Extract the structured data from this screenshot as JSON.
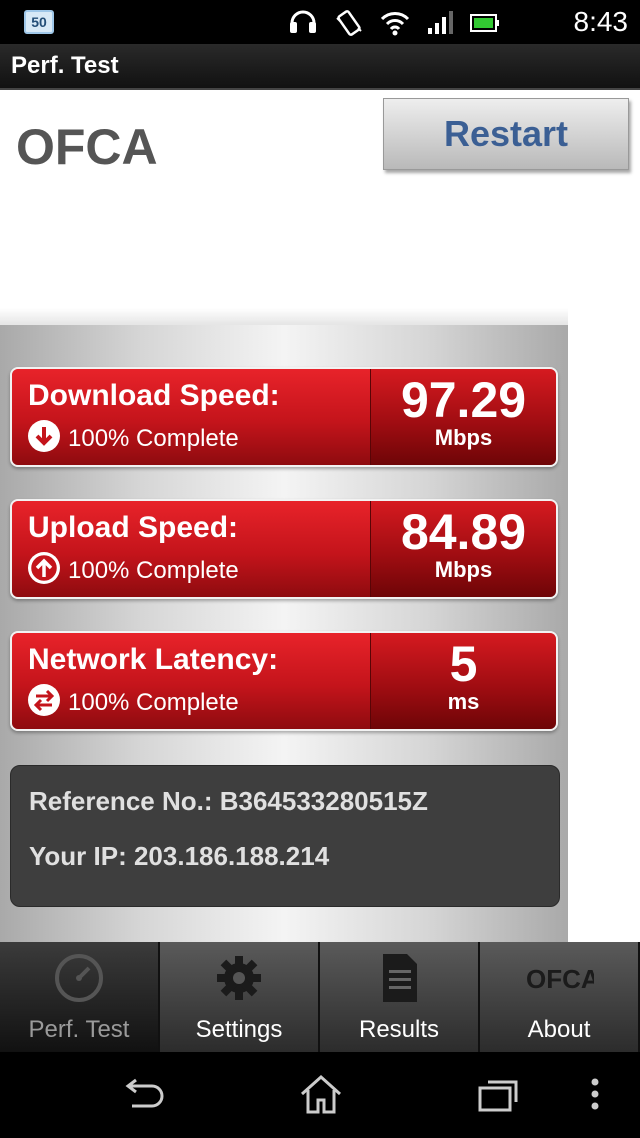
{
  "status_bar": {
    "badge": "50",
    "time": "8:43"
  },
  "action_bar": {
    "title": "Perf. Test"
  },
  "header": {
    "logo_text": "OFCA",
    "restart_label": "Restart"
  },
  "metrics": [
    {
      "label": "Download Speed:",
      "status": "100% Complete",
      "value": "97.29",
      "unit": "Mbps",
      "icon": "arrow-down-circle-icon"
    },
    {
      "label": "Upload Speed:",
      "status": "100% Complete",
      "value": "84.89",
      "unit": "Mbps",
      "icon": "arrow-up-circle-icon"
    },
    {
      "label": "Network Latency:",
      "status": "100% Complete",
      "value": "5",
      "unit": "ms",
      "icon": "swap-arrows-circle-icon"
    }
  ],
  "info": {
    "reference": "Reference No.: B364533280515Z",
    "ip": "Your IP: 203.186.188.214"
  },
  "tabs": [
    {
      "label": "Perf. Test",
      "icon": "speedometer-icon",
      "active": true
    },
    {
      "label": "Settings",
      "icon": "gear-icon",
      "active": false
    },
    {
      "label": "Results",
      "icon": "document-icon",
      "active": false
    },
    {
      "label": "About",
      "icon": "ofca-logo-icon",
      "active": false
    }
  ],
  "colors": {
    "metric_red": "#c4141b",
    "restart_text": "#3b5f94",
    "info_bg": "#3e3e3e"
  }
}
